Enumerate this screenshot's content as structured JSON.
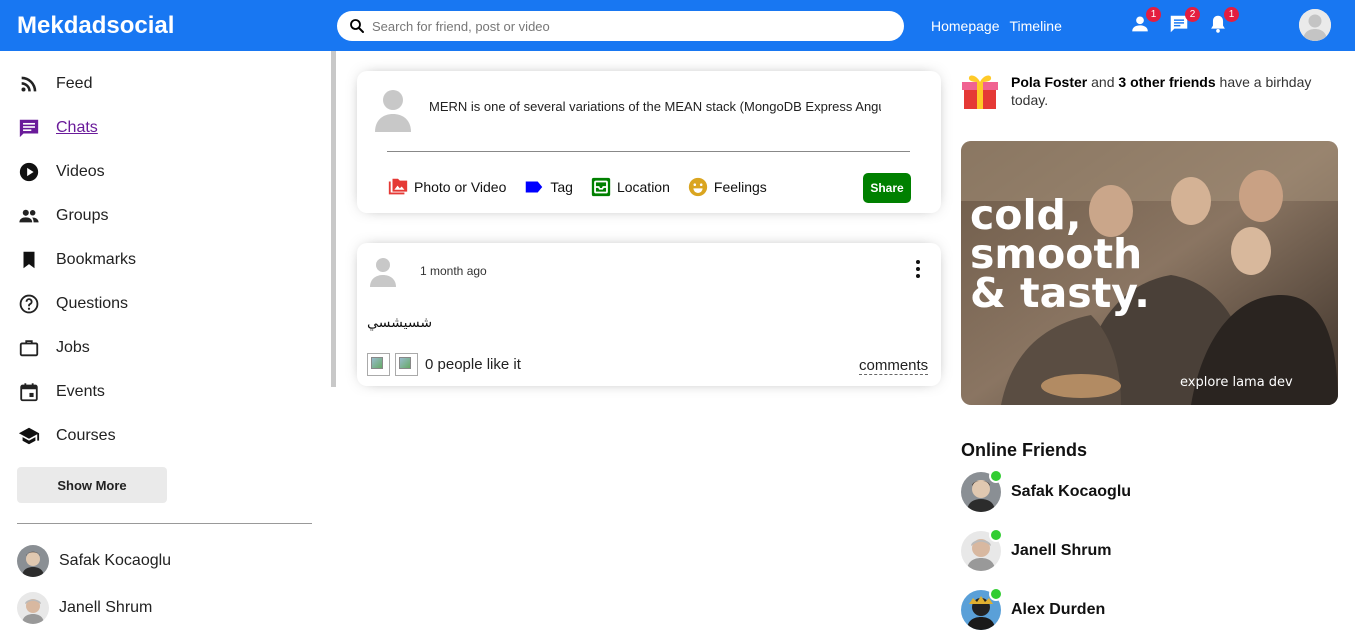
{
  "app": {
    "title": "Mekdadsocial"
  },
  "search": {
    "placeholder": "Search for friend, post or video"
  },
  "nav": {
    "homepage": "Homepage",
    "timeline": "Timeline"
  },
  "notifications": {
    "friends": "1",
    "messages": "2",
    "alerts": "1"
  },
  "sidebar": {
    "items": [
      {
        "label": "Feed",
        "icon": "rss-feed-icon"
      },
      {
        "label": "Chats",
        "icon": "chat-icon",
        "active": true
      },
      {
        "label": "Videos",
        "icon": "play-circle-icon"
      },
      {
        "label": "Groups",
        "icon": "group-icon"
      },
      {
        "label": "Bookmarks",
        "icon": "bookmark-icon"
      },
      {
        "label": "Questions",
        "icon": "help-outline-icon"
      },
      {
        "label": "Jobs",
        "icon": "work-outline-icon"
      },
      {
        "label": "Events",
        "icon": "event-icon"
      },
      {
        "label": "Courses",
        "icon": "school-icon"
      }
    ],
    "show_more": "Show More",
    "friends": [
      {
        "name": "Safak Kocaoglu"
      },
      {
        "name": "Janell Shrum"
      }
    ]
  },
  "share": {
    "text": "MERN is one of several variations of the MEAN stack (MongoDB Express Angular Node.js)",
    "options": [
      {
        "label": "Photo or Video",
        "icon": "perm-media-icon",
        "color": "#e53935"
      },
      {
        "label": "Tag",
        "icon": "label-icon",
        "color": "#0000ff"
      },
      {
        "label": "Location",
        "icon": "room-icon",
        "color": "#008000"
      },
      {
        "label": "Feelings",
        "icon": "emoji-emotions-icon",
        "color": "#daa520"
      }
    ],
    "button": "Share"
  },
  "post": {
    "time": "1 month ago",
    "text": "شسيشسي",
    "likes": "0 people like it",
    "comments": "comments"
  },
  "birthday": {
    "name": "Pola Foster",
    "connector": " and ",
    "others": "3 other friends",
    "suffix": " have a birhday today."
  },
  "ad": {
    "headline_1": "cold,",
    "headline_2": "smooth",
    "headline_3": "& tasty.",
    "tagline": "explore lama dev"
  },
  "online": {
    "title": "Online Friends",
    "friends": [
      {
        "name": "Safak Kocaoglu"
      },
      {
        "name": "Janell Shrum"
      },
      {
        "name": "Alex Durden"
      }
    ]
  },
  "colors": {
    "topbar": "#1877f2",
    "active_nav": "#6a1b9a",
    "share_button": "#008000",
    "online_dot": "#32cd32",
    "badge": "#e41e3f"
  }
}
